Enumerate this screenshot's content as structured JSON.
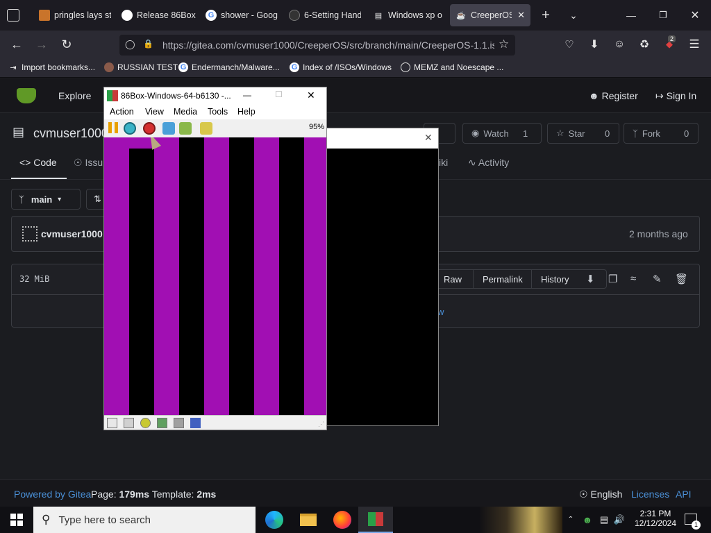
{
  "browser": {
    "tabs": [
      {
        "label": "pringles lays st",
        "icon": "tab-favicon-icon"
      },
      {
        "label": "Release 86Box",
        "icon": "github-icon"
      },
      {
        "label": "shower - Goog",
        "icon": "google-icon"
      },
      {
        "label": "6-Setting Hand",
        "icon": "tab-favicon-icon"
      },
      {
        "label": "Windows xp o",
        "icon": "archive-icon"
      },
      {
        "label": "CreeperOS/",
        "icon": "gitea-icon"
      }
    ],
    "url": "https://gitea.com/cvmuser1000/CreeperOS/src/branch/main/CreeperOS-1.1.is",
    "extension_badge": "2",
    "bookmarks": [
      {
        "label": "Import bookmarks...",
        "icon": "import-icon"
      },
      {
        "label": "RUSSIAN TEST",
        "icon": "bookmark-favicon-icon"
      },
      {
        "label": "Endermanch/Malware...",
        "icon": "google-icon"
      },
      {
        "label": "Index of /ISOs/Windows",
        "icon": "google-icon"
      },
      {
        "label": "MEMZ and Noescape ...",
        "icon": "globe-icon"
      }
    ]
  },
  "gitea": {
    "nav": {
      "explore": "Explore",
      "register": "Register",
      "sign_in": "Sign In"
    },
    "repo_owner": "cvmuser1000",
    "watch": {
      "label": "Watch",
      "count": "1"
    },
    "star": {
      "label": "Star",
      "count": "0"
    },
    "fork": {
      "label": "Fork",
      "count": "0"
    },
    "tabs": {
      "code": "Code",
      "issues": "Issu",
      "wiki": "iki",
      "activity": "Activity"
    },
    "branch": "main",
    "commit_author": "cvmuser1000",
    "commit_time": "2 months ago",
    "file_size": "32 MiB",
    "file_buttons": {
      "raw": "Raw",
      "permalink": "Permalink",
      "history": "History"
    },
    "view_link": "w",
    "footer": {
      "powered_by": "Powered by Gitea",
      "page_label": "Page:",
      "page_time": "179ms",
      "template_label": "Template:",
      "template_time": "2ms",
      "language": "English",
      "licenses": "Licenses",
      "api": "API"
    }
  },
  "emulator": {
    "title": "86Box-Windows-64-b6130 -...",
    "menu": [
      "Action",
      "View",
      "Media",
      "Tools",
      "Help"
    ],
    "speed": "95%",
    "stripe_color": "#a10fb3"
  },
  "taskbar": {
    "search_placeholder": "Type here to search",
    "time": "2:31 PM",
    "date": "12/12/2024",
    "notification_count": "1"
  }
}
